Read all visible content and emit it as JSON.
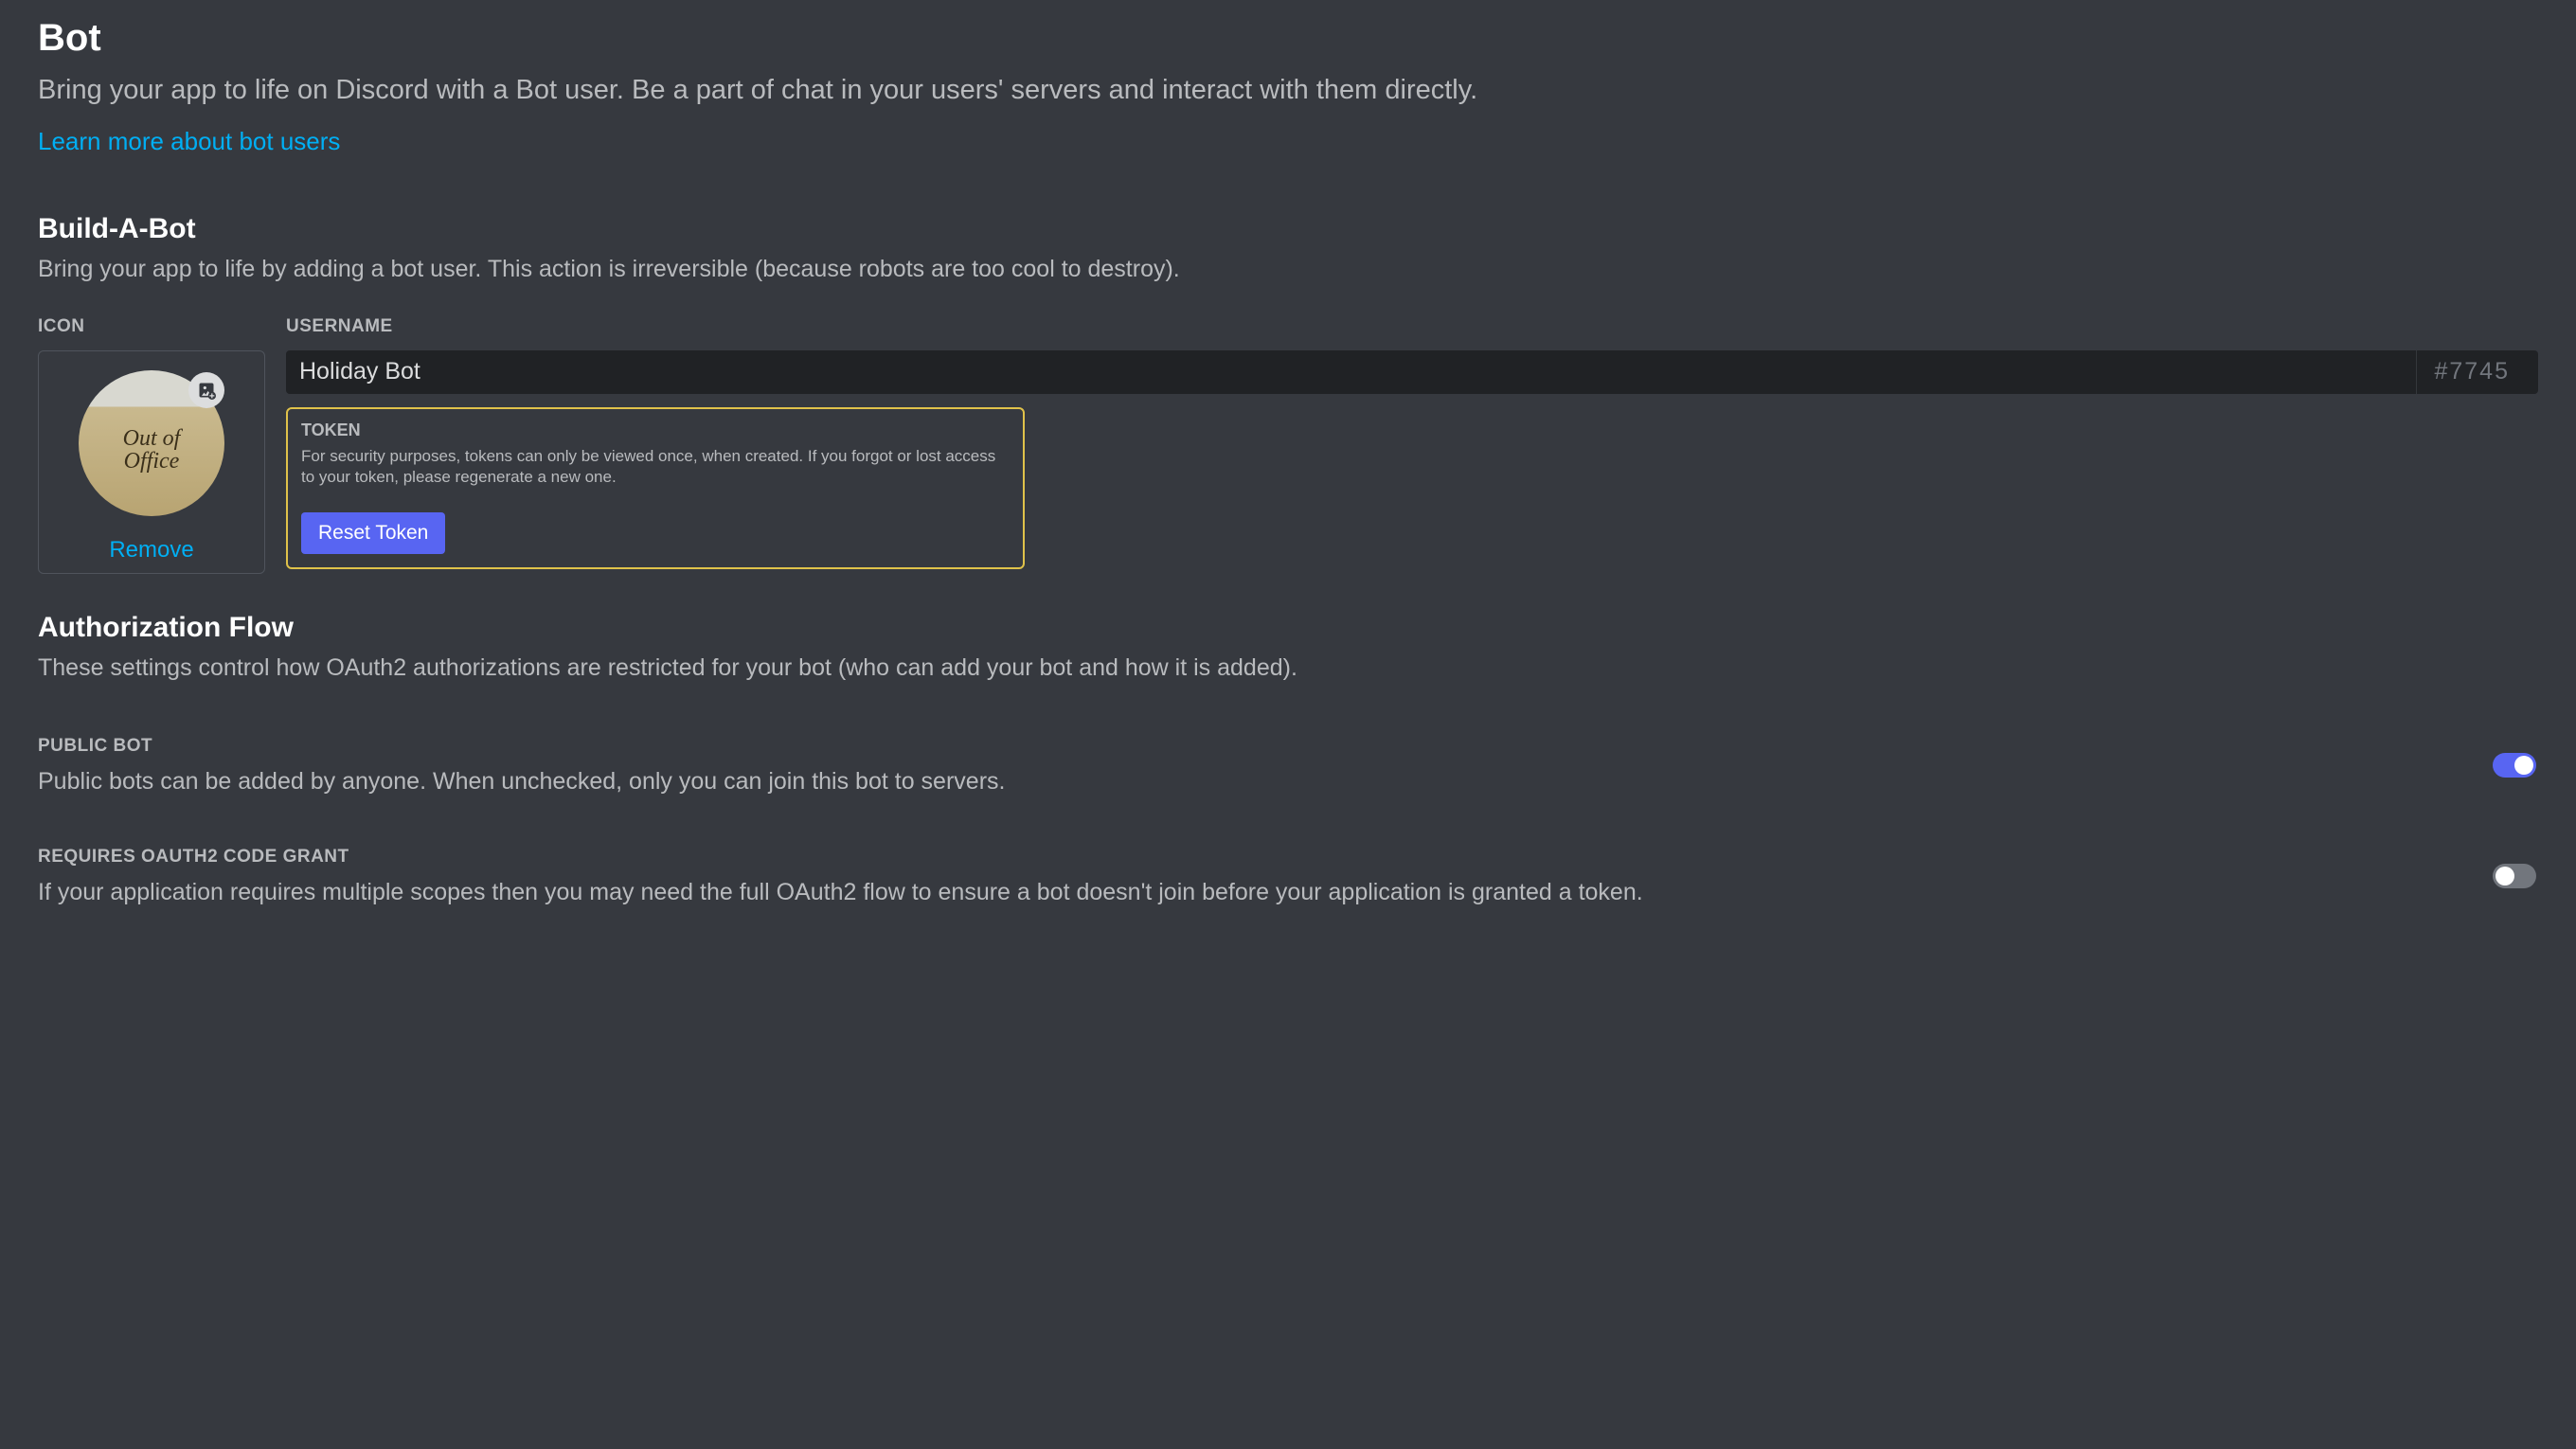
{
  "header": {
    "title": "Bot",
    "description": "Bring your app to life on Discord with a Bot user. Be a part of chat in your users' servers and interact with them directly.",
    "learn_more": "Learn more about bot users"
  },
  "build": {
    "title": "Build-A-Bot",
    "description": "Bring your app to life by adding a bot user. This action is irreversible (because robots are too cool to destroy).",
    "icon_label": "ICON",
    "avatar_text": "Out of Office",
    "remove": "Remove",
    "username_label": "USERNAME",
    "username_value": "Holiday Bot",
    "username_tag": "#7745",
    "token_label": "TOKEN",
    "token_desc": "For security purposes, tokens can only be viewed once, when created. If you forgot or lost access to your token, please regenerate a new one.",
    "reset_button": "Reset Token"
  },
  "auth": {
    "title": "Authorization Flow",
    "description": "These settings control how OAuth2 authorizations are restricted for your bot (who can add your bot and how it is added).",
    "public_bot": {
      "label": "PUBLIC BOT",
      "description": "Public bots can be added by anyone. When unchecked, only you can join this bot to servers.",
      "enabled": true
    },
    "code_grant": {
      "label": "REQUIRES OAUTH2 CODE GRANT",
      "description": "If your application requires multiple scopes then you may need the full OAuth2 flow to ensure a bot doesn't join before your application is granted a token.",
      "enabled": false
    }
  }
}
